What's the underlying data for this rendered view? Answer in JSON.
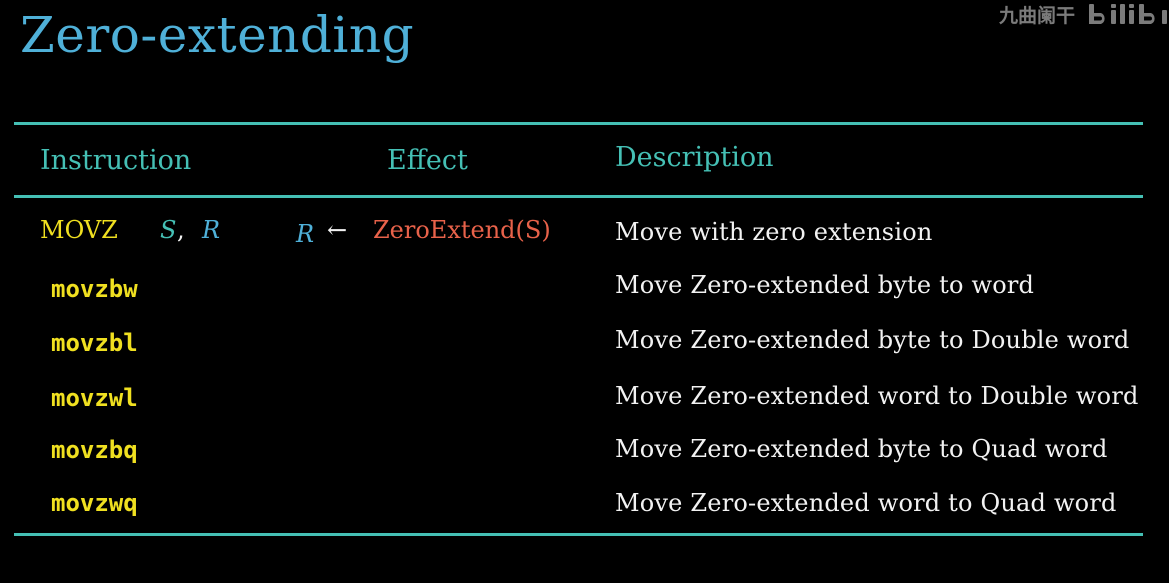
{
  "title": "Zero-extending",
  "watermark": {
    "text": "九曲阑干",
    "logo": "bilibili"
  },
  "table": {
    "headers": {
      "instruction": "Instruction",
      "effect": "Effect",
      "description": "Description"
    },
    "class_row": {
      "mnemonic": "MOVZ",
      "operand_source": "S",
      "operand_separator": ",",
      "operand_dest": "R",
      "effect_dest": "R",
      "effect_arrow": "←",
      "effect_expression": "ZeroExtend(S)",
      "description": "Move with zero extension"
    },
    "rows": [
      {
        "instruction": "movzbw",
        "description": "Move Zero-extended byte to word"
      },
      {
        "instruction": "movzbl",
        "description": "Move Zero-extended byte to Double word"
      },
      {
        "instruction": "movzwl",
        "description": "Move Zero-extended word to Double word"
      },
      {
        "instruction": "movzbq",
        "description": "Move Zero-extended byte to Quad word"
      },
      {
        "instruction": "movzwq",
        "description": "Move Zero-extended word to Quad word"
      }
    ]
  },
  "colors": {
    "background": "#000000",
    "title": "#4fb0d8",
    "rule": "#45c0b5",
    "header": "#45c0b5",
    "mnemonic": "#f0e020",
    "description": "#f2f2f2",
    "effect_expression": "#e8624a",
    "operand_register": "#4fb0d8",
    "operand_source": "#45c0b5"
  }
}
